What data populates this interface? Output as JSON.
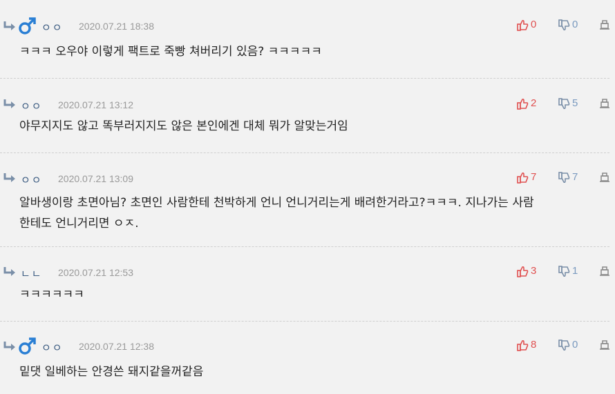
{
  "comments": [
    {
      "author": "ㅇㅇ",
      "gender_icon": "male-icon",
      "date": "2020.07.21 18:38",
      "upvotes": "0",
      "downvotes": "0",
      "text_lines": [
        "ㅋㅋㅋ 오우야 이렇게 팩트로 죽빵 쳐버리기 있음? ㅋㅋㅋㅋㅋ"
      ]
    },
    {
      "author": "ㅇㅇ",
      "date": "2020.07.21 13:12",
      "upvotes": "2",
      "downvotes": "5",
      "text_lines": [
        "야무지지도 않고 똑부러지지도 않은 본인에겐 대체 뭐가 알맞는거임"
      ]
    },
    {
      "author": "ㅇㅇ",
      "date": "2020.07.21 13:09",
      "upvotes": "7",
      "downvotes": "7",
      "text_lines": [
        "알바생이랑 초면아님? 초면인 사람한테 천박하게 언니 언니거리는게 배려한거라고?ㅋㅋㅋ. 지나가는 사람",
        "한테도 언니거리면 ㅇㅈ."
      ]
    },
    {
      "author": "ㄴㄴ",
      "date": "2020.07.21 12:53",
      "upvotes": "3",
      "downvotes": "1",
      "text_lines": [
        "ㅋㅋㅋㅋㅋㅋ"
      ]
    },
    {
      "author": "ㅇㅇ",
      "gender_icon": "male-icon",
      "date": "2020.07.21 12:38",
      "upvotes": "8",
      "downvotes": "0",
      "text_lines": [
        "밑댓 일베하는 안경쓴 돼지같을꺼같음"
      ]
    }
  ],
  "colors": {
    "background": "#f2f2f2",
    "author": "#3a5a80",
    "date": "#999999",
    "upvote": "#e05050",
    "downvote": "#7a9abf",
    "male_icon": "#2a7fd4"
  }
}
